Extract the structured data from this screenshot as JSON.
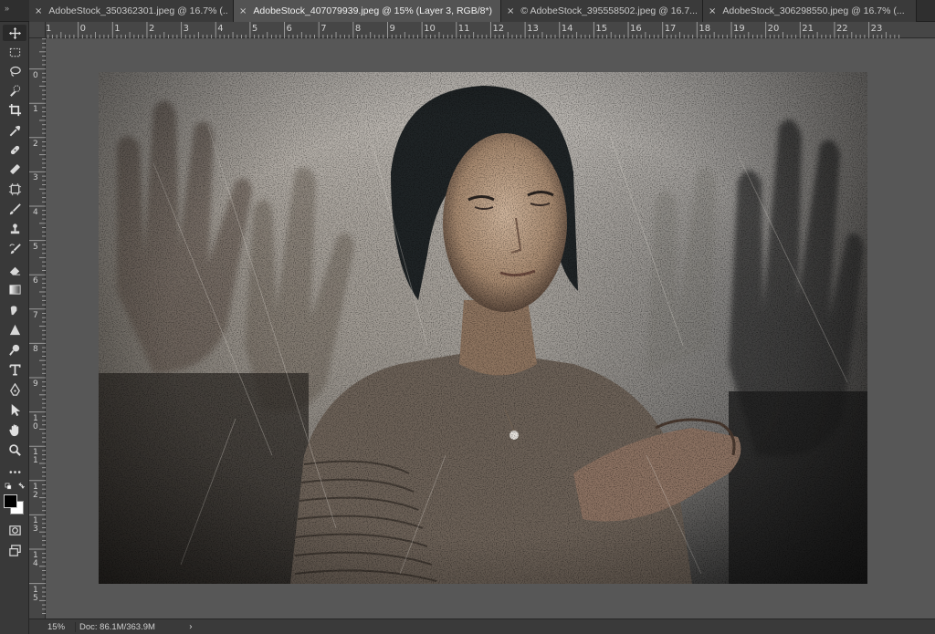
{
  "tabs": [
    {
      "label": "AdobeStock_350362301.jpeg @ 16.7% (...",
      "active": false
    },
    {
      "label": "AdobeStock_407079939.jpeg @ 15% (Layer 3, RGB/8*) *",
      "active": true
    },
    {
      "label": "© AdobeStock_395558502.jpeg @ 16.7...",
      "active": false
    },
    {
      "label": "AdobeStock_306298550.jpeg @ 16.7% (...",
      "active": false
    }
  ],
  "tab_close_symbol": "×",
  "tab_gutter_symbol": "»",
  "tools": [
    "move-icon",
    "marquee-icon",
    "lasso-icon",
    "quick-select-icon",
    "crop-icon",
    "eyedropper-icon",
    "healing-brush-icon",
    "bandage-icon",
    "frame-icon",
    "brush-icon",
    "stamp-icon",
    "history-brush-icon",
    "eraser-icon",
    "gradient-icon",
    "smudge-icon",
    "sharpen-icon",
    "dodge-icon",
    "type-icon",
    "pen-icon",
    "path-select-icon",
    "hand-icon",
    "zoom-icon",
    "more-tools-icon"
  ],
  "ruler": {
    "top_labels": [
      "1",
      "0",
      "1",
      "2",
      "3",
      "4",
      "5",
      "6",
      "7",
      "8",
      "9",
      "10",
      "11",
      "12",
      "13",
      "14",
      "15",
      "16",
      "17",
      "18",
      "19",
      "20",
      "21",
      "22",
      "23"
    ],
    "left_labels": [
      "1",
      "0",
      "1",
      "2",
      "3",
      "4",
      "5",
      "6",
      "7",
      "8",
      "9",
      "10",
      "11",
      "12",
      "13",
      "14",
      "15"
    ]
  },
  "colors": {
    "foreground": "#000000",
    "background": "#ffffff",
    "app_bg": "#535353",
    "panel_bg": "#393939"
  },
  "status": {
    "zoom": "15%",
    "doc": "Doc: 86.1M/363.9M",
    "arrow": "›"
  }
}
